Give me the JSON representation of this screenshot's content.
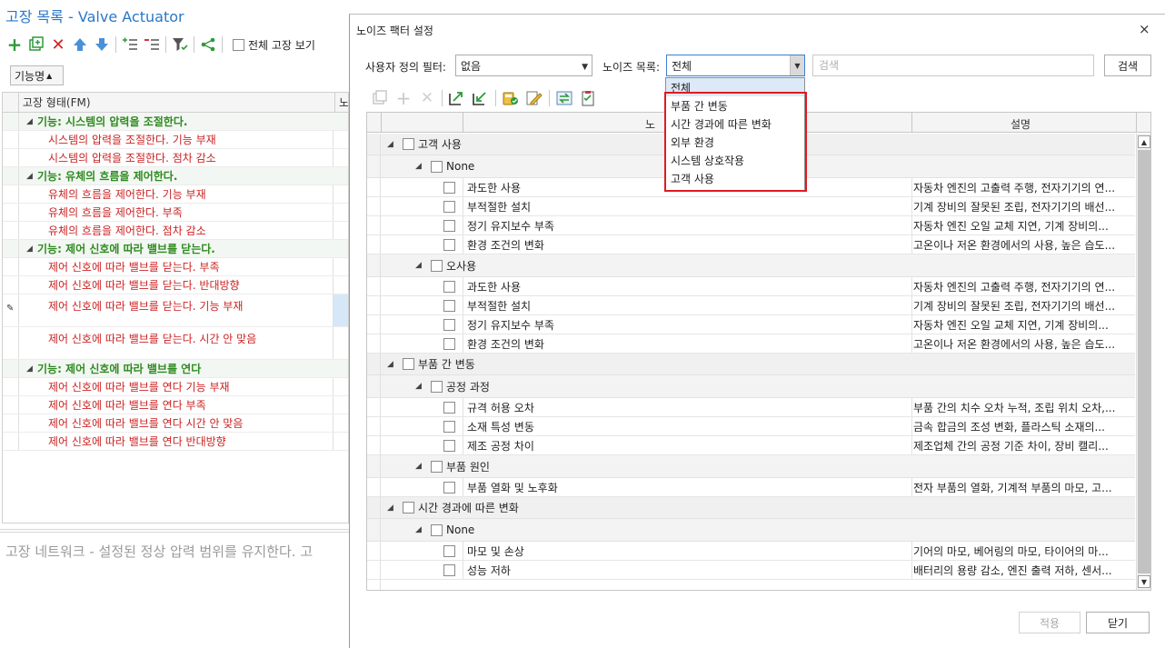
{
  "background": {
    "title": "고장 목록 - Valve Actuator",
    "show_all_label": "전체 고장 보기",
    "sort_button_label": "기능명",
    "grid_header": [
      "고장 형태(FM)",
      "노"
    ],
    "rows": [
      {
        "kind": "func",
        "text": "기능: 시스템의 압력을 조절한다."
      },
      {
        "kind": "fm",
        "text": "시스템의 압력을 조절한다. 기능 부재"
      },
      {
        "kind": "fm",
        "text": "시스템의 압력을 조절한다. 점차 감소"
      },
      {
        "kind": "func",
        "text": "기능: 유체의 흐름을 제어한다."
      },
      {
        "kind": "fm",
        "text": "유체의 흐름을 제어한다. 기능 부재"
      },
      {
        "kind": "fm",
        "text": "유체의 흐름을 제어한다. 부족"
      },
      {
        "kind": "fm",
        "text": "유체의 흐름을 제어한다. 점차 감소"
      },
      {
        "kind": "func",
        "text": "기능: 제어 신호에 따라 밸브를 닫는다."
      },
      {
        "kind": "fm",
        "text": "제어 신호에 따라 밸브를 닫는다. 부족"
      },
      {
        "kind": "fm",
        "text": "제어 신호에 따라 밸브를 닫는다. 반대방향"
      },
      {
        "kind": "fm-tall-sel",
        "text": "제어 신호에 따라 밸브를 닫는다. 기능 부재"
      },
      {
        "kind": "fm-tall",
        "text": "제어 신호에 따라 밸브를 닫는다. 시간 안 맞음"
      },
      {
        "kind": "func",
        "text": "기능: 제어 신호에 따라 밸브를 연다"
      },
      {
        "kind": "fm",
        "text": "제어 신호에 따라 밸브를 연다 기능 부재"
      },
      {
        "kind": "fm",
        "text": "제어 신호에 따라 밸브를 연다 부족"
      },
      {
        "kind": "fm",
        "text": "제어 신호에 따라 밸브를 연다 시간 안 맞음"
      },
      {
        "kind": "fm",
        "text": "제어 신호에 따라 밸브를 연다 반대방향"
      }
    ],
    "status_text": "고장 네트워크 - 설정된 정상 압력 범위를 유지한다. 고"
  },
  "dialog": {
    "title": "노이즈 팩터 설정",
    "close_icon": "×",
    "user_filter_label": "사용자 정의 필터:",
    "user_filter_value": "없음",
    "noise_list_label": "노이즈 목록:",
    "noise_list_value": "전체",
    "search_placeholder": "검색",
    "search_button": "검색",
    "columns": [
      "노",
      "설명"
    ],
    "apply_button": "적용",
    "close_button": "닫기",
    "dropdown_options": [
      "전체",
      "부품 간 변동",
      "시간 경과에 따른 변화",
      "외부 환경",
      "시스템 상호작용",
      "고객 사용"
    ],
    "dropdown_selected": "전체",
    "tree_rows": [
      {
        "level": 1,
        "name": "고객 사용",
        "desc": ""
      },
      {
        "level": 2,
        "name": "None",
        "desc": ""
      },
      {
        "level": 3,
        "name": "과도한 사용",
        "desc": "자동차 엔진의 고출력 주행, 전자기기의 연..."
      },
      {
        "level": 3,
        "name": "부적절한 설치",
        "desc": "기계 장비의 잘못된 조립, 전자기기의 배선..."
      },
      {
        "level": 3,
        "name": "정기 유지보수 부족",
        "desc": "자동차 엔진 오일 교체 지연, 기계 장비의..."
      },
      {
        "level": 3,
        "name": "환경 조건의 변화",
        "desc": "고온이나 저온 환경에서의 사용, 높은 습도..."
      },
      {
        "level": 2,
        "name": "오사용",
        "desc": ""
      },
      {
        "level": 3,
        "name": "과도한 사용",
        "desc": "자동차 엔진의 고출력 주행, 전자기기의 연..."
      },
      {
        "level": 3,
        "name": "부적절한 설치",
        "desc": "기계 장비의 잘못된 조립, 전자기기의 배선..."
      },
      {
        "level": 3,
        "name": "정기 유지보수 부족",
        "desc": "자동차 엔진 오일 교체 지연, 기계 장비의..."
      },
      {
        "level": 3,
        "name": "환경 조건의 변화",
        "desc": "고온이나 저온 환경에서의 사용, 높은 습도..."
      },
      {
        "level": 1,
        "name": "부품 간 변동",
        "desc": ""
      },
      {
        "level": 2,
        "name": "공정 과정",
        "desc": ""
      },
      {
        "level": 3,
        "name": "규격 허용 오차",
        "desc": "부품 간의 치수 오차 누적, 조립 위치 오차,..."
      },
      {
        "level": 3,
        "name": "소재 특성 변동",
        "desc": "금속 합금의 조성 변화, 플라스틱 소재의..."
      },
      {
        "level": 3,
        "name": "제조 공정 차이",
        "desc": "제조업체 간의 공정 기준 차이, 장비 캘리..."
      },
      {
        "level": 2,
        "name": "부품 원인",
        "desc": ""
      },
      {
        "level": 3,
        "name": "부품 열화 및 노후화",
        "desc": "전자 부품의 열화, 기계적 부품의 마모, 고..."
      },
      {
        "level": 1,
        "name": "시간 경과에 따른 변화",
        "desc": ""
      },
      {
        "level": 2,
        "name": "None",
        "desc": ""
      },
      {
        "level": 3,
        "name": "마모 및 손상",
        "desc": "기어의 마모, 베어링의 마모, 타이어의 마..."
      },
      {
        "level": 3,
        "name": "성능 저하",
        "desc": "배터리의 용량 감소, 엔진 출력 저하, 센서..."
      }
    ]
  },
  "colors": {
    "title_blue": "#2a78c8",
    "function_green": "#2e8b1f",
    "failure_red": "#cc2222",
    "highlight_red": "#e01a22",
    "combo_focus": "#3c7fd3"
  }
}
